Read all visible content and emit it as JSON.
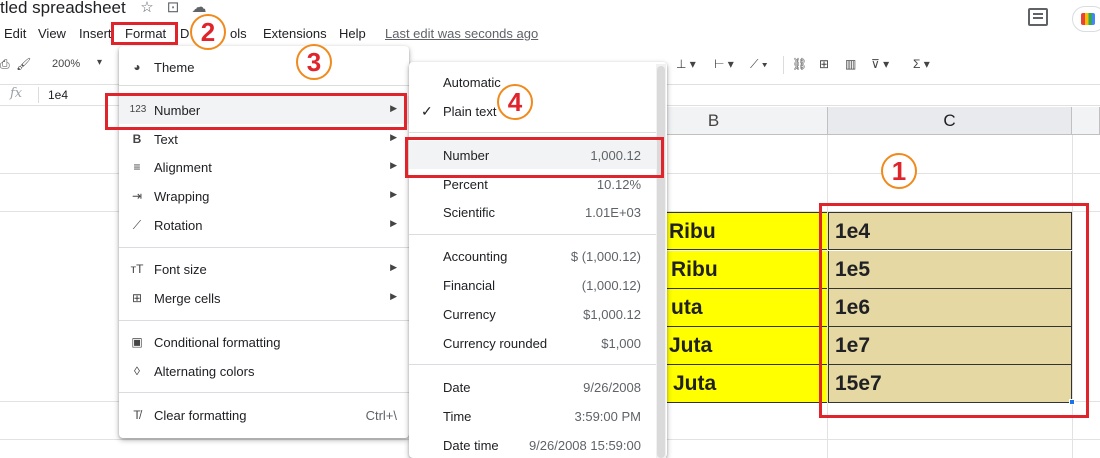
{
  "title": {
    "doc_title": "tled spreadsheet"
  },
  "menubar": {
    "items": [
      "Edit",
      "View",
      "Insert",
      "Format",
      "D",
      "ols",
      "Extensions",
      "Help"
    ],
    "last_edit": "Last edit was seconds ago"
  },
  "toolbar": {
    "zoom": "200%"
  },
  "formula_bar": {
    "fx": "fx",
    "value": "1e4"
  },
  "columns": [
    "B",
    "C"
  ],
  "rows": [
    {
      "b": "Ribu",
      "c": "1e4"
    },
    {
      "b": "Ribu",
      "c": "1e5"
    },
    {
      "b": "uta",
      "c": "1e6"
    },
    {
      "b": "Juta",
      "c": "1e7"
    },
    {
      "b": "Juta",
      "c": "15e7"
    }
  ],
  "format_menu": {
    "items": [
      {
        "label": "Theme",
        "icon": "palette-icon"
      },
      {
        "label": "Number",
        "icon": "number-format-icon",
        "icon_text": "123",
        "has_submenu": true
      },
      {
        "label": "Text",
        "icon": "bold-icon",
        "icon_text": "B",
        "has_submenu": true
      },
      {
        "label": "Alignment",
        "icon": "align-icon",
        "has_submenu": true
      },
      {
        "label": "Wrapping",
        "icon": "wrap-icon",
        "has_submenu": true
      },
      {
        "label": "Rotation",
        "icon": "rotation-icon",
        "has_submenu": true
      },
      {
        "label": "Font size",
        "icon": "font-size-icon",
        "has_submenu": true
      },
      {
        "label": "Merge cells",
        "icon": "merge-icon",
        "has_submenu": true
      },
      {
        "label": "Conditional formatting",
        "icon": "paint-roller-icon"
      },
      {
        "label": "Alternating colors",
        "icon": "drop-icon"
      },
      {
        "label": "Clear formatting",
        "icon": "clear-format-icon",
        "shortcut": "Ctrl+\\"
      }
    ]
  },
  "number_submenu": {
    "items": [
      {
        "label": "Automatic",
        "value": ""
      },
      {
        "label": "Plain text",
        "value": "",
        "checked": true
      },
      {
        "label": "Number",
        "value": "1,000.12"
      },
      {
        "label": "Percent",
        "value": "10.12%"
      },
      {
        "label": "Scientific",
        "value": "1.01E+03"
      },
      {
        "label": "Accounting",
        "value": "$ (1,000.12)"
      },
      {
        "label": "Financial",
        "value": "(1,000.12)"
      },
      {
        "label": "Currency",
        "value": "$1,000.12"
      },
      {
        "label": "Currency rounded",
        "value": "$1,000"
      },
      {
        "label": "Date",
        "value": "9/26/2008"
      },
      {
        "label": "Time",
        "value": "3:59:00 PM"
      },
      {
        "label": "Date time",
        "value": "9/26/2008 15:59:00"
      }
    ],
    "check_mark": "✓"
  },
  "annotations": {
    "badges": [
      "1",
      "2",
      "3",
      "4"
    ]
  },
  "colors": {
    "highlight_yellow": "#ffff00",
    "cell_tan": "#e6d8a3",
    "annotation_red": "#e0242b",
    "badge_orange": "#f08a1c"
  }
}
